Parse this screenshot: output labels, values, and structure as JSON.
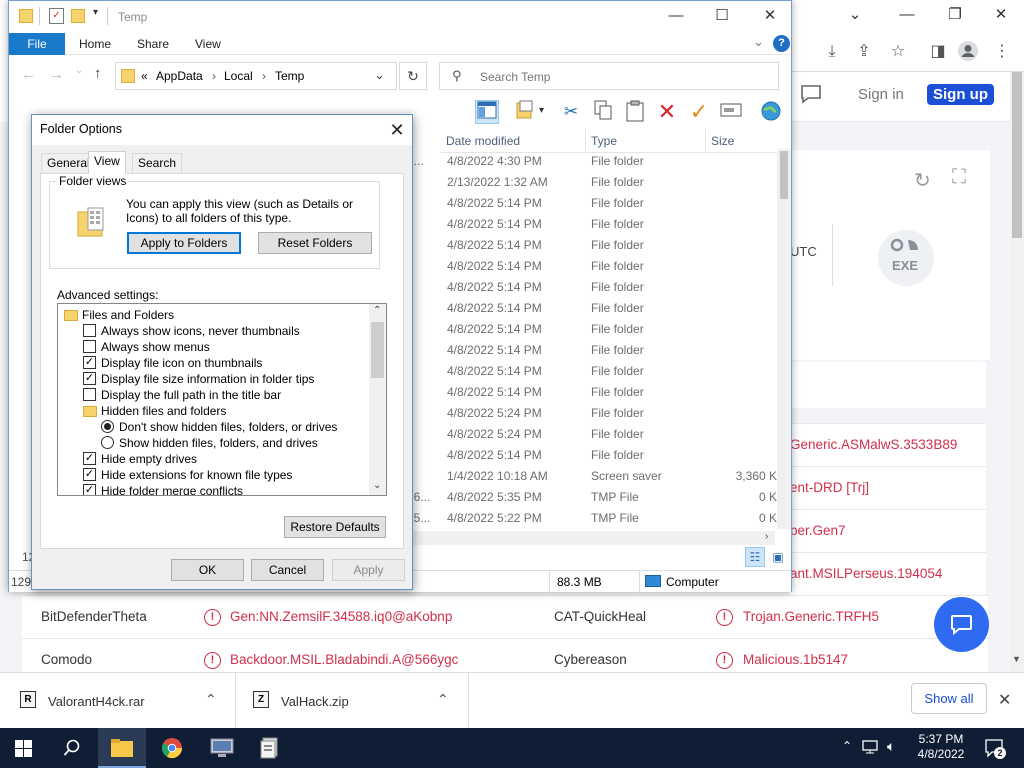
{
  "chrome": {
    "signin": "Sign in",
    "signup": "Sign up",
    "utc_fragment": "UTC",
    "exe_label": "EXE",
    "detections_right": [
      "Generic.ASMalwS.3533B89",
      "ent-DRD [Trj]",
      "per.Gen7",
      "ant.MSILPerseus.194054"
    ],
    "rows": [
      {
        "av1": "BitDefenderTheta",
        "det1": "Gen:NN.ZemsilF.34588.iq0@aKobnp",
        "av2": "CAT-QuickHeal",
        "det2": "Trojan.Generic.TRFH5"
      },
      {
        "av1": "Comodo",
        "det1": "Backdoor.MSIL.Bladabindi.A@566ygc",
        "av2": "Cybereason",
        "det2": "Malicious.1b5147"
      }
    ],
    "left_fragments": [
      "12",
      "129"
    ],
    "accent": "#1a4fd6",
    "danger": "#d32f4a"
  },
  "downloads": {
    "items": [
      {
        "name": "ValorantH4ck.rar"
      },
      {
        "name": "ValHack.zip"
      }
    ],
    "show_all": "Show all"
  },
  "explorer": {
    "title": "Temp",
    "ribbon": {
      "file": "File",
      "home": "Home",
      "share": "Share",
      "view": "View"
    },
    "path": {
      "prefix": "«",
      "seg1": "AppData",
      "seg2": "Local",
      "seg3": "Temp"
    },
    "search_placeholder": "Search Temp",
    "columns": {
      "date": "Date modified",
      "type": "Type",
      "size": "Size"
    },
    "files": [
      {
        "frag": "3...",
        "date": "4/8/2022 4:30 PM",
        "type": "File folder",
        "size": ""
      },
      {
        "frag": "",
        "date": "2/13/2022 1:32 AM",
        "type": "File folder",
        "size": ""
      },
      {
        "frag": "",
        "date": "4/8/2022 5:14 PM",
        "type": "File folder",
        "size": ""
      },
      {
        "frag": "",
        "date": "4/8/2022 5:14 PM",
        "type": "File folder",
        "size": ""
      },
      {
        "frag": "",
        "date": "4/8/2022 5:14 PM",
        "type": "File folder",
        "size": ""
      },
      {
        "frag": "",
        "date": "4/8/2022 5:14 PM",
        "type": "File folder",
        "size": ""
      },
      {
        "frag": "",
        "date": "4/8/2022 5:14 PM",
        "type": "File folder",
        "size": ""
      },
      {
        "frag": "",
        "date": "4/8/2022 5:14 PM",
        "type": "File folder",
        "size": ""
      },
      {
        "frag": "",
        "date": "4/8/2022 5:14 PM",
        "type": "File folder",
        "size": ""
      },
      {
        "frag": "",
        "date": "4/8/2022 5:14 PM",
        "type": "File folder",
        "size": ""
      },
      {
        "frag": "",
        "date": "4/8/2022 5:14 PM",
        "type": "File folder",
        "size": ""
      },
      {
        "frag": "",
        "date": "4/8/2022 5:14 PM",
        "type": "File folder",
        "size": ""
      },
      {
        "frag": "",
        "date": "4/8/2022 5:24 PM",
        "type": "File folder",
        "size": ""
      },
      {
        "frag": "",
        "date": "4/8/2022 5:24 PM",
        "type": "File folder",
        "size": ""
      },
      {
        "frag": "",
        "date": "4/8/2022 5:14 PM",
        "type": "File folder",
        "size": ""
      },
      {
        "frag": "",
        "date": "1/4/2022 10:18 AM",
        "type": "Screen saver",
        "size": "3,360 KB"
      },
      {
        "frag": "76...",
        "date": "4/8/2022 5:35 PM",
        "type": "TMP File",
        "size": "0 KB"
      },
      {
        "frag": "15...",
        "date": "4/8/2022 5:22 PM",
        "type": "TMP File",
        "size": "0 KB"
      }
    ],
    "status": {
      "size": "88.3 MB",
      "location": "Computer"
    }
  },
  "dialog": {
    "title": "Folder Options",
    "tabs": {
      "general": "General",
      "view": "View",
      "search": "Search"
    },
    "folder_views": {
      "label": "Folder views",
      "text": "You can apply this view (such as Details or Icons) to all folders of this type.",
      "apply": "Apply to Folders",
      "reset": "Reset Folders"
    },
    "advanced_label": "Advanced settings:",
    "advanced": [
      {
        "kind": "folder",
        "label": "Files and Folders",
        "indent": 0
      },
      {
        "kind": "check",
        "checked": false,
        "label": "Always show icons, never thumbnails",
        "indent": 1
      },
      {
        "kind": "check",
        "checked": false,
        "label": "Always show menus",
        "indent": 1
      },
      {
        "kind": "check",
        "checked": true,
        "label": "Display file icon on thumbnails",
        "indent": 1
      },
      {
        "kind": "check",
        "checked": true,
        "label": "Display file size information in folder tips",
        "indent": 1
      },
      {
        "kind": "check",
        "checked": false,
        "label": "Display the full path in the title bar",
        "indent": 1
      },
      {
        "kind": "folder",
        "label": "Hidden files and folders",
        "indent": 1
      },
      {
        "kind": "radio",
        "checked": true,
        "label": "Don't show hidden files, folders, or drives",
        "indent": 2
      },
      {
        "kind": "radio",
        "checked": false,
        "label": "Show hidden files, folders, and drives",
        "indent": 2
      },
      {
        "kind": "check",
        "checked": true,
        "label": "Hide empty drives",
        "indent": 1
      },
      {
        "kind": "check",
        "checked": true,
        "label": "Hide extensions for known file types",
        "indent": 1
      },
      {
        "kind": "check",
        "checked": true,
        "label": "Hide folder merge conflicts",
        "indent": 1
      }
    ],
    "restore": "Restore Defaults",
    "ok": "OK",
    "cancel": "Cancel",
    "apply": "Apply"
  },
  "taskbar": {
    "time": "5:37 PM",
    "date": "4/8/2022",
    "notifications": "2"
  }
}
